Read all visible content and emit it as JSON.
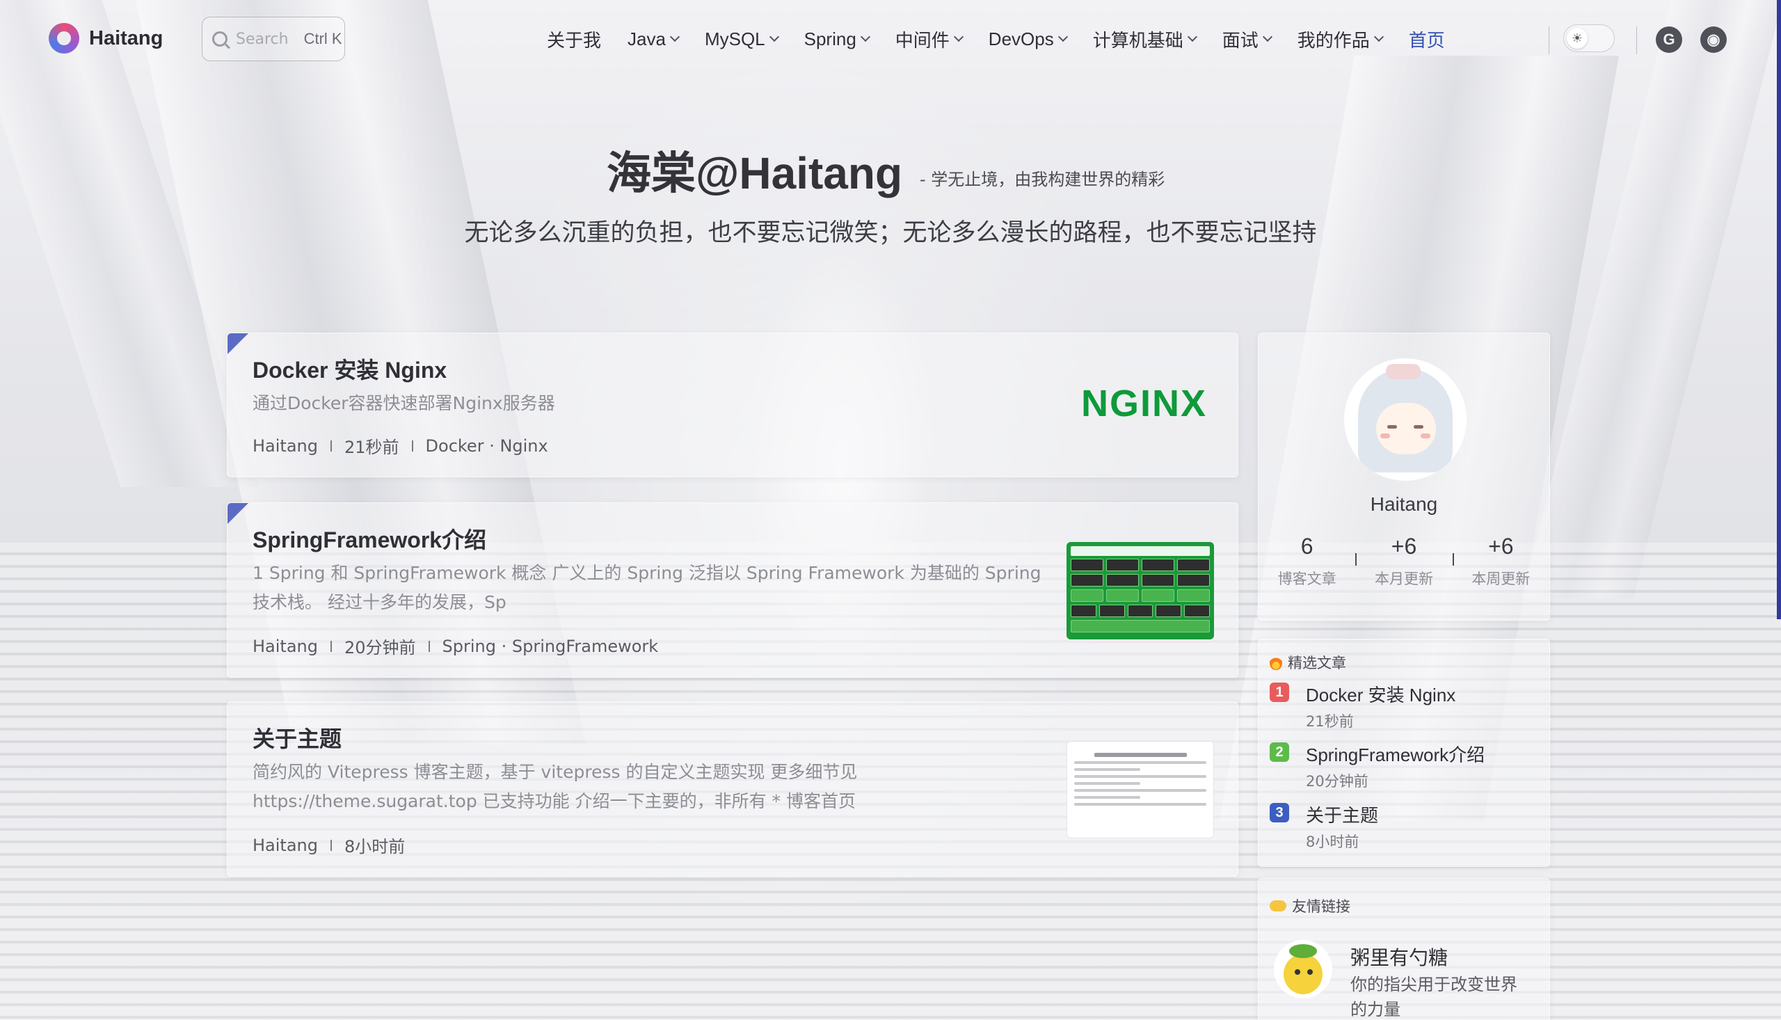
{
  "site": {
    "name": "Haitang"
  },
  "search": {
    "placeholder": "Search",
    "shortcut": "Ctrl K"
  },
  "nav": {
    "items": [
      {
        "label": "关于我",
        "dropdown": false
      },
      {
        "label": "Java",
        "dropdown": true
      },
      {
        "label": "MySQL",
        "dropdown": true
      },
      {
        "label": "Spring",
        "dropdown": true
      },
      {
        "label": "中间件",
        "dropdown": true
      },
      {
        "label": "DevOps",
        "dropdown": true
      },
      {
        "label": "计算机基础",
        "dropdown": true
      },
      {
        "label": "面试",
        "dropdown": true
      },
      {
        "label": "我的作品",
        "dropdown": true
      },
      {
        "label": "首页",
        "dropdown": false,
        "active": true
      }
    ],
    "icons": [
      "theme-toggle-icon",
      "gitee-icon",
      "github-icon"
    ]
  },
  "hero": {
    "title": "海棠@Haitang",
    "subtitle": "- 学无止境，由我构建世界的精彩",
    "motto": "无论多么沉重的负担，也不要忘记微笑；无论多么漫长的路程，也不要忘记坚持"
  },
  "posts": [
    {
      "title": "Docker 安装 Nginx",
      "desc": "通过Docker容器快速部署Nginx服务器",
      "author": "Haitang",
      "time": "21秒前",
      "tags": "Docker · Nginx",
      "pinned": true,
      "cover": "NGINX"
    },
    {
      "title": "SpringFramework介绍",
      "desc": "1 Spring 和 SpringFramework 概念 广义上的 Spring 泛指以 Spring Framework 为基础的 Spring 技术栈。 经过十多年的发展，Sp",
      "author": "Haitang",
      "time": "20分钟前",
      "tags": "Spring · SpringFramework",
      "pinned": true
    },
    {
      "title": "关于主题",
      "desc": "简约风的 Vitepress 博客主题，基于 vitepress 的自定义主题实现 更多细节见 https://theme.sugarat.top 已支持功能 介绍一下主要的，非所有 * 博客首页",
      "author": "Haitang",
      "time": "8小时前",
      "pinned": false
    }
  ],
  "profile": {
    "name": "Haitang",
    "stats": [
      {
        "value": "6",
        "label": "博客文章"
      },
      {
        "value": "+6",
        "label": "本月更新"
      },
      {
        "value": "+6",
        "label": "本周更新"
      }
    ]
  },
  "featured": {
    "heading": "精选文章",
    "items": [
      {
        "rank": "1",
        "title": "Docker 安装 Nginx",
        "time": "21秒前",
        "color": "#e85c5c"
      },
      {
        "rank": "2",
        "title": "SpringFramework介绍",
        "time": "20分钟前",
        "color": "#5dbb4a"
      },
      {
        "rank": "3",
        "title": "关于主题",
        "time": "8小时前",
        "color": "#3b5fc0"
      }
    ]
  },
  "friends": {
    "heading": "友情链接",
    "items": [
      {
        "name": "粥里有勺糖",
        "desc": "你的指尖用于改变世界的力量"
      }
    ]
  },
  "colors": {
    "accent": "#3451b2",
    "pin": "#5b6bc4",
    "nginx": "#0e9a3a",
    "scrollbar": "#2f3a9a"
  }
}
